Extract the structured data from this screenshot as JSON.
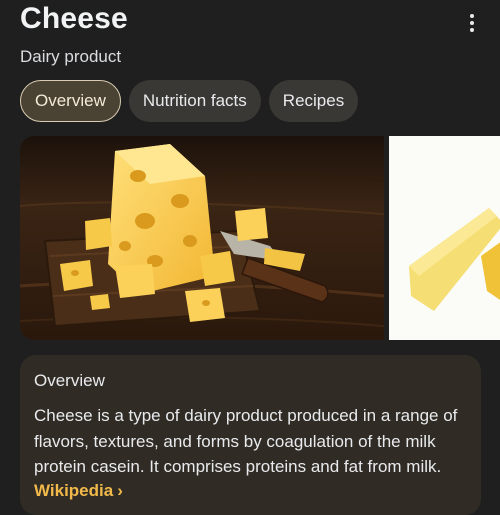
{
  "header": {
    "title": "Cheese",
    "subtitle": "Dairy product",
    "more_icon": "more-vert-icon"
  },
  "tabs": [
    {
      "label": "Overview",
      "active": true
    },
    {
      "label": "Nutrition facts",
      "active": false
    },
    {
      "label": "Recipes",
      "active": false
    }
  ],
  "images": [
    {
      "subject": "swiss-cheese-board-with-knife"
    },
    {
      "subject": "yellow-cheese-slices"
    }
  ],
  "overview_card": {
    "heading": "Overview",
    "body": "Cheese is a type of dairy product produced in a range of flavors, textures, and forms by coagulation of the milk protein casein. It comprises proteins and fat from milk.",
    "source_label": "Wikipedia",
    "source_chevron": "›"
  },
  "colors": {
    "background": "#1f1f1f",
    "card": "#302c25",
    "tab": "#3a3834",
    "tab_active": "#4a4233",
    "link": "#f0b94a"
  }
}
